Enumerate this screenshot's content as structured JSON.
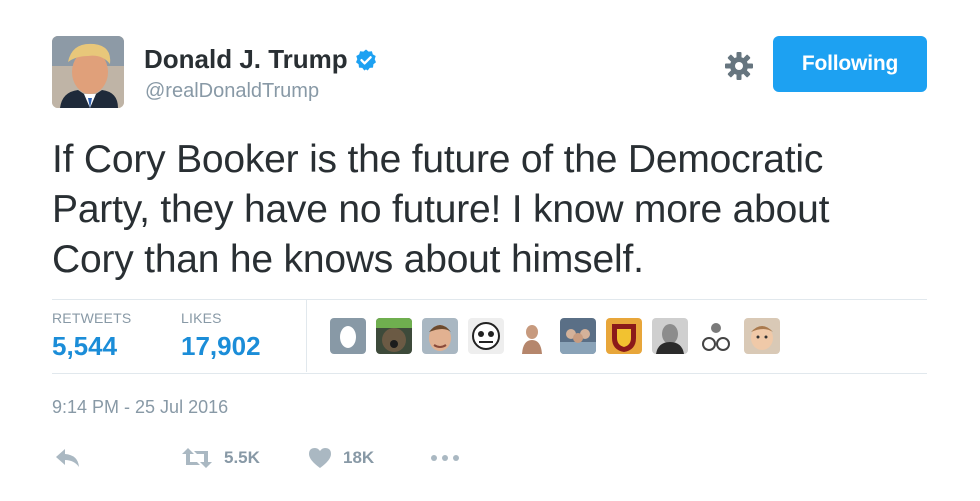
{
  "user": {
    "name": "Donald J. Trump",
    "handle": "@realDonaldTrump",
    "verified_icon": "verified-badge-icon",
    "avatar_icon": "profile-photo"
  },
  "header": {
    "settings_icon": "gear-icon",
    "follow_button_label": "Following",
    "accent_color": "#1da1f2"
  },
  "tweet": {
    "lines": [
      "If Cory Booker is the future of the Democratic",
      "Party, they have no future! I know more about",
      "Cory than he knows about himself."
    ]
  },
  "stats": {
    "retweets_label": "RETWEETS",
    "retweets_value": "5,544",
    "likes_label": "LIKES",
    "likes_value": "17,902",
    "liker_avatars": [
      "default-egg-avatar",
      "dog-avatar",
      "man-avatar",
      "cartoon-avatar",
      "person-avatar",
      "group-avatar",
      "crest-logo-avatar",
      "man-avatar-2",
      "bikes-avatar",
      "child-avatar"
    ]
  },
  "timestamp": "9:14 PM - 25 Jul 2016",
  "actions": {
    "reply_icon": "reply-icon",
    "retweet_icon": "retweet-icon",
    "retweet_count": "5.5K",
    "like_icon": "heart-icon",
    "like_count": "18K",
    "more_icon": "more-dots-icon"
  }
}
